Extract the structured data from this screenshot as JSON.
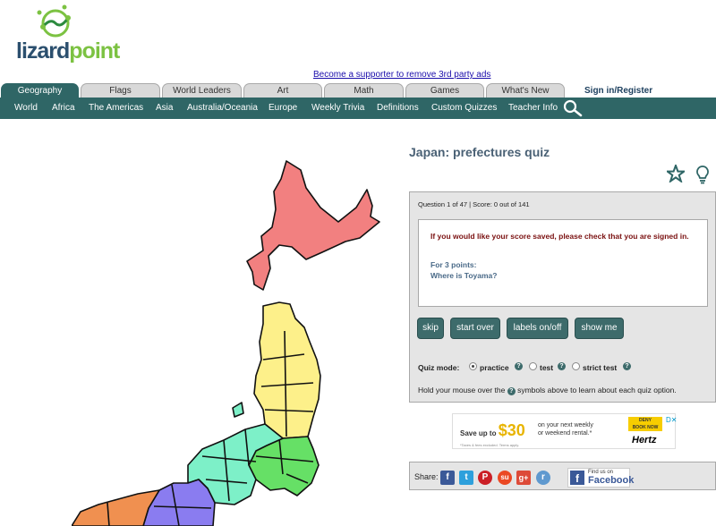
{
  "logo": {
    "part1": "lizard",
    "part2": "point"
  },
  "supporter_link": "Become a supporter to remove 3rd party ads",
  "tabs": [
    {
      "label": "Geography",
      "active": true
    },
    {
      "label": "Flags"
    },
    {
      "label": "World Leaders"
    },
    {
      "label": "Art"
    },
    {
      "label": "Math"
    },
    {
      "label": "Games"
    },
    {
      "label": "What's New"
    }
  ],
  "signin": "Sign in/Register",
  "subnav": [
    "World",
    "Africa",
    "The Americas",
    "Asia",
    "Australia/Oceania",
    "Europe",
    "Weekly Trivia",
    "Definitions",
    "Custom Quizzes",
    "Teacher Info"
  ],
  "quiz": {
    "title": "Japan: prefectures quiz",
    "status": "Question 1 of 47 | Score: 0 out of 141",
    "warning": "If you would like your score saved, please check that you are signed in.",
    "points": "For 3 points:",
    "question": "Where is Toyama?",
    "buttons": {
      "skip": "skip",
      "start_over": "start over",
      "labels": "labels on/off",
      "show_me": "show me"
    },
    "mode_label": "Quiz mode:",
    "modes": {
      "practice": "practice",
      "test": "test",
      "strict": "strict test"
    },
    "selected_mode": "practice",
    "help_prefix": "Hold your mouse over the",
    "help_suffix": "symbols above to learn about each quiz option.",
    "help_symbol": "?"
  },
  "ad": {
    "prefix": "Save up to",
    "amount": "$30",
    "line1": "on your next weekly",
    "line2": "or weekend rental.*",
    "fine": "*Taxes & fees excluded. Terms apply.",
    "badge1": "DENY",
    "badge2": "BOOK NOW",
    "brand": "Hertz",
    "close": "D✕"
  },
  "share": {
    "label": "Share:",
    "icons": [
      {
        "name": "facebook-icon",
        "glyph": "f",
        "color": "#3b5998"
      },
      {
        "name": "twitter-icon",
        "glyph": "t",
        "color": "#2ea0dc"
      },
      {
        "name": "pinterest-icon",
        "glyph": "P",
        "color": "#cb2027"
      },
      {
        "name": "stumbleupon-icon",
        "glyph": "su",
        "color": "#eb4924"
      },
      {
        "name": "googleplus-icon",
        "glyph": "g+",
        "color": "#dd4b39"
      },
      {
        "name": "reddit-icon",
        "glyph": "r",
        "color": "#5f99cf"
      }
    ],
    "fb_small": "Find us on",
    "fb_big": "Facebook"
  },
  "colors": {
    "nav": "#2f6666",
    "hokkaido": "#f28080",
    "tohoku": "#fdf08a",
    "kanto": "#66e066",
    "chubu": "#7df0c8",
    "kinki": "#8a7cf0",
    "chugoku": "#f09050"
  }
}
